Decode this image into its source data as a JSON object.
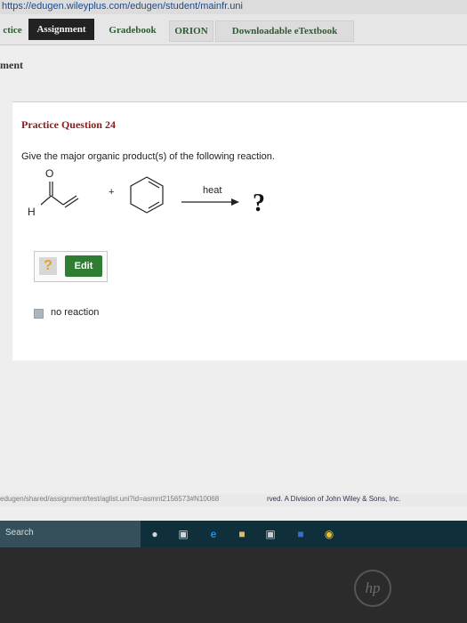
{
  "browser": {
    "url": "https://edugen.wileyplus.com/edugen/student/mainfr.uni"
  },
  "tabs": [
    {
      "label": "ctice"
    },
    {
      "label": "Assignment"
    },
    {
      "label": "Gradebook"
    },
    {
      "label": "ORION"
    },
    {
      "label": "Downloadable eTextbook"
    }
  ],
  "section": {
    "title": "ment"
  },
  "question": {
    "title": "Practice Question 24",
    "prompt": "Give the major organic product(s) of the following reaction.",
    "reaction": {
      "atom_o": "O",
      "atom_h": "H",
      "plus": "+",
      "condition": "heat",
      "product": "?"
    }
  },
  "answer": {
    "placeholder_symbol": "?",
    "edit_label": "Edit",
    "no_reaction_label": "no reaction"
  },
  "statusbar": {
    "url": "edugen/shared/assignment/test/aglist.uni?id=asmnt2156573#N10068",
    "copyright": "rved. A Division of John Wiley & Sons, Inc."
  },
  "taskbar": {
    "search_label": "Search"
  },
  "device": {
    "logo_text": "hp"
  },
  "colors": {
    "active_tab": "#222222",
    "edit_button": "#2e7d32",
    "question_title": "#8a1c1c",
    "taskbar": "#0f2f3a"
  }
}
